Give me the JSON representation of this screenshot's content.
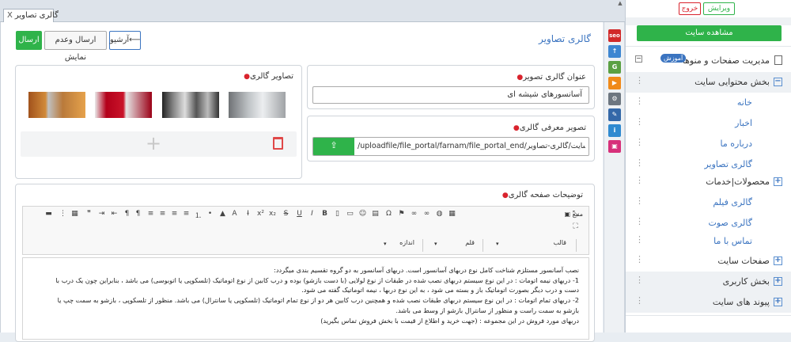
{
  "tab": {
    "title": "گالری تصاویر",
    "close": "X"
  },
  "page": {
    "title": "گالری تصاویر"
  },
  "actions": {
    "send": "ارسال",
    "send_hidden": "ارسال وعدم نمایش",
    "archive": "آرشیو",
    "archive_arrow": "⟵"
  },
  "gallery_title_field": {
    "label": "عنوان گالری تصویر",
    "value": "آسانسورهای شیشه ای"
  },
  "intro_image_field": {
    "label": "تصویر معرفی گالری",
    "value": "/uploadfile/file_portal/farnam/file_portal_end/بخش-محتوایی-سایت/گالری-تصاویر",
    "upload_icon": "upload-icon"
  },
  "gallery_images": {
    "label": "تصاویر گالری",
    "count": 4,
    "add_icon": "plus-icon",
    "delete_icon": "trash-icon"
  },
  "description": {
    "label": "توضیحات صفحه گالری",
    "toolbar": {
      "source": "منبع",
      "format": "قالب",
      "font": "قلم",
      "size": "اندازه"
    },
    "lines": [
      "نصب آسانسور مستلزم شناخت کامل نوع دربهای آسانسور است. دربهای آسانسور به دو گروه تقسیم بندی میگردد:",
      "1- دربهای نیمه اتومات : در این نوع سیستم دربهای نصب شده در طبقات از نوع لولایی (با دست بازشو) بوده و درب کابین از نوع اتوماتیک (تلسکوپی یا اتوبوسی) می باشد ، بنابراین چون یک درب با",
      "دست و درب دیگر بصورت اتوماتیک باز و بسته می شود ، به این نوع دربها ، نیمه اتوماتیک گفته می شود.",
      "2- دربهای تمام اتومات : در این نوع سیستم دربهای طبقات نصب شده و همچنین درب کابین هر دو از نوع تمام اتوماتیک (تلسکوپی یا سانترال) می باشد. منظور از تلسکوپی ، بازشو به سمت چپ یا",
      "بازشو به سمت راست و منظور از سانترال بازشو از وسط می باشد.",
      "دربهای مورد فروش در این مجموعه :  (جهت خرید و اطلاع از قیمت با بخش فروش تماس بگیرید)"
    ]
  },
  "sidebar": {
    "edit": "ویرایش",
    "logout": "خروج",
    "view_site": "مشاهده سایت",
    "manage": "مدیریت صفحات و منوها",
    "badge": "آموزش",
    "sections": [
      {
        "label": "بخش محتوایی سایت",
        "toggle": "−"
      },
      {
        "label": "محصولات|خدمات",
        "toggle": "+"
      },
      {
        "label": "صفحات سایت",
        "toggle": "+"
      },
      {
        "label": "بخش کاربری",
        "toggle": "+"
      },
      {
        "label": "پیوند های سایت",
        "toggle": "+"
      }
    ],
    "items": [
      "خانه",
      "اخبار",
      "درباره ما",
      "گالری تصاویر"
    ],
    "items2": [
      "گالری فیلم",
      "گالری صوت",
      "تماس با ما"
    ]
  },
  "tools": [
    "seo",
    "tool-2",
    "tool-3",
    "tool-4",
    "settings",
    "wrench",
    "info",
    "tool-8"
  ],
  "colors": {
    "green": "#2fb34a",
    "blue": "#3b74c0",
    "red": "#d9232d"
  }
}
